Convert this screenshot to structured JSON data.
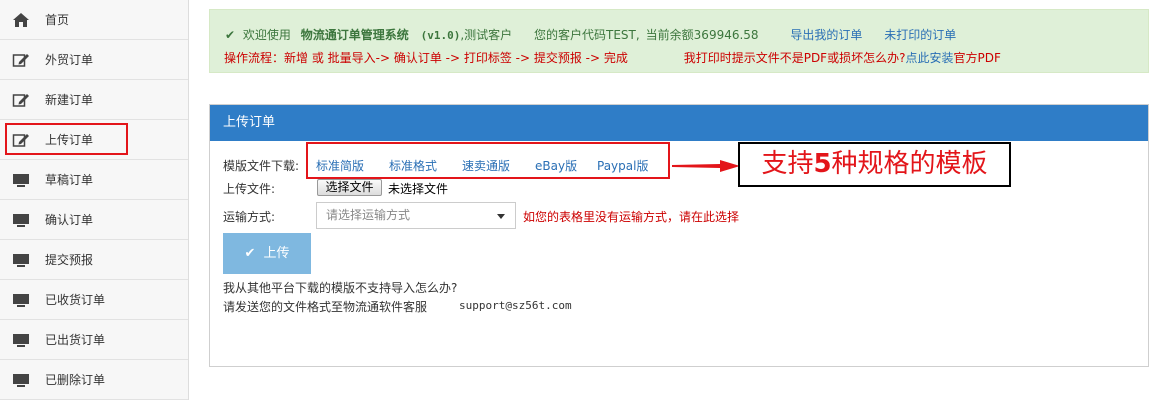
{
  "sidebar": {
    "items": [
      {
        "label": "首页",
        "icon": "home-icon"
      },
      {
        "label": "外贸订单",
        "icon": "edit-icon"
      },
      {
        "label": "新建订单",
        "icon": "edit-icon"
      },
      {
        "label": "上传订单",
        "icon": "edit-icon",
        "highlighted": true
      },
      {
        "label": "草稿订单",
        "icon": "monitor-icon"
      },
      {
        "label": "确认订单",
        "icon": "monitor-icon"
      },
      {
        "label": "提交预报",
        "icon": "monitor-icon"
      },
      {
        "label": "已收货订单",
        "icon": "monitor-icon"
      },
      {
        "label": "已出货订单",
        "icon": "monitor-icon"
      },
      {
        "label": "已删除订单",
        "icon": "monitor-icon"
      }
    ]
  },
  "notice": {
    "welcome": "欢迎使用",
    "system_name": "物流通订单管理系统",
    "version": "(v1.0)",
    "user": ",测试客户",
    "customer_code": "您的客户代码TEST,",
    "balance": "当前余额369946.58",
    "export_link": "导出我的订单",
    "unprinted_link": "未打印的订单",
    "workflow": "操作流程：新增 或 批量导入-> 确认订单 -> 打印标签 -> 提交预报 -> 完成",
    "pdf_question": "我打印时提示文件不是PDF或损坏怎么办?",
    "pdf_link": "点此安装",
    "pdf_suffix": "官方PDF"
  },
  "panel": {
    "title": "上传订单",
    "template_label": "模版文件下载:",
    "templates": [
      "标准简版",
      "标准格式",
      "速卖通版",
      "eBay版",
      "Paypal版"
    ],
    "callout": {
      "pre": "支持",
      "num": "5",
      "post": "种规格的模板"
    },
    "upload_file_label": "上传文件:",
    "choose_file": "选择文件",
    "no_file": "未选择文件",
    "shipping_label": "运输方式:",
    "shipping_placeholder": "请选择运输方式",
    "shipping_hint": "如您的表格里没有运输方式，请在此选择",
    "upload_button": "上传",
    "faq_question": "我从其他平台下载的模版不支持导入怎么办?",
    "faq_answer": "请发送您的文件格式至物流通软件客服",
    "support_email": "support@sz56t.com"
  },
  "colors": {
    "accent": "#2f7dc7",
    "highlight": "#e3151a",
    "notice_bg": "#dff0d8"
  }
}
